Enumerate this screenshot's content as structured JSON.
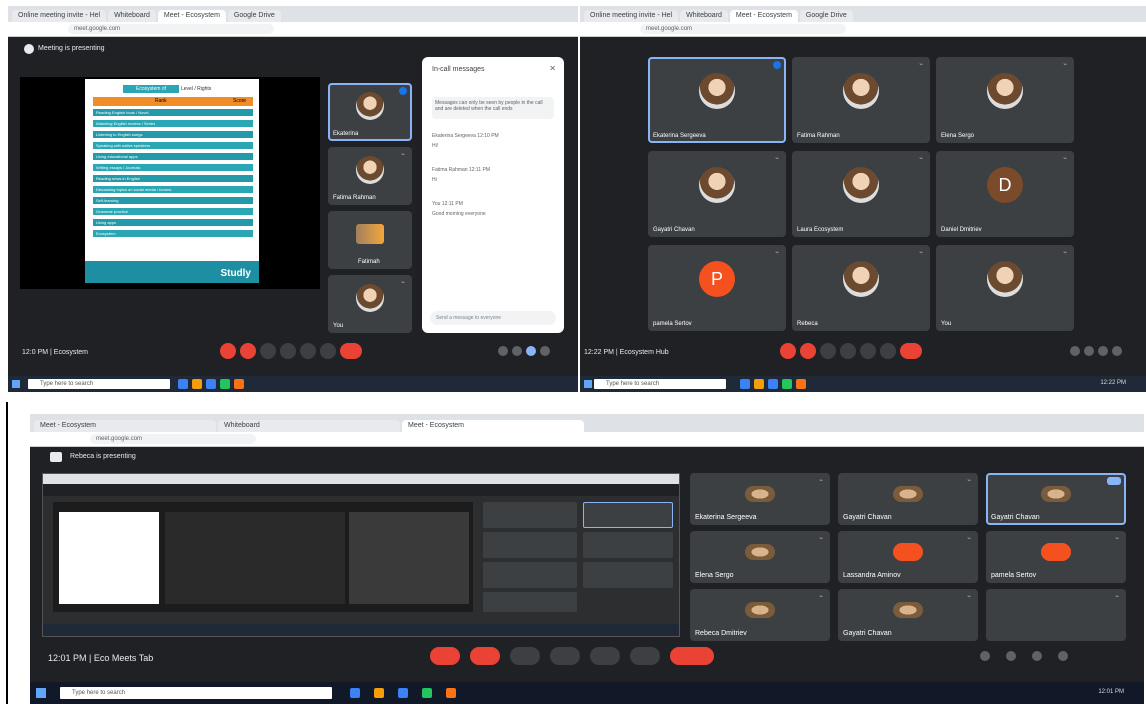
{
  "top_left": {
    "tabs": [
      "Online meeting invite - Hel",
      "Whiteboard",
      "Meet - Ecosystem",
      "Google Drive"
    ],
    "url": "meet.google.com",
    "meeting_title": "Meeting is presenting",
    "time_code": "12:0 PM | Ecosystem",
    "presenter_name": "Ekaterina",
    "presenter_short": "Fatim",
    "slide_header_left": "Ecosystem of",
    "slide_header_right": "Level / Rights",
    "slide_col_a": "Rank",
    "slide_col_b": "Score",
    "slide_rows": [
      "Reading English book / Novel",
      "Watching English movies / Series",
      "Listening to English songs",
      "Speaking with native speakers",
      "Using educational apps",
      "Writing essays / Journals",
      "Reading news in English",
      "Discussing topics on social media / forums",
      "Self-learning",
      "Grammar practice",
      "Using apps",
      "Ecosystem"
    ],
    "slide_brand": "Studly",
    "search_placeholder": "Type here to search",
    "chat": {
      "title": "In-call messages",
      "note": "Messages can only be seen by people in the call and are deleted when the call ends",
      "messages": [
        "Ekaterina Sergeeva 12:10 PM",
        "Hi!",
        "Fatima Rahman 12:11 PM",
        "Hi",
        "You 12:11 PM",
        "Good morning everyone"
      ],
      "input_placeholder": "Send a message to everyone"
    },
    "side_tiles": [
      "Ekaterina",
      "Fatima Rahman",
      "Fatimah",
      "You"
    ]
  },
  "top_right": {
    "time_code": "12:22 PM | Ecosystem Hub",
    "tiles": [
      {
        "name": "Ekaterina Sergeeva",
        "avatar": "photo"
      },
      {
        "name": "Fatima Rahman",
        "avatar": "photo"
      },
      {
        "name": "Elena Sergo",
        "avatar": "photo"
      },
      {
        "name": "Gayatri Chavan",
        "avatar": "photo"
      },
      {
        "name": "Laura Ecosystem",
        "avatar": "photo"
      },
      {
        "name": "Daniel Dmitriev",
        "avatar": "D"
      },
      {
        "name": "pamela Sertov",
        "avatar": "P"
      },
      {
        "name": "Rebeca",
        "avatar": "photo"
      },
      {
        "name": "You",
        "avatar": "photo"
      }
    ],
    "search_placeholder": "Type here to search",
    "clock": "12:22 PM"
  },
  "bottom": {
    "tabs": [
      "Meet - Ecosystem",
      "Whiteboard",
      "Meet - Ecosystem"
    ],
    "meeting_title": "Rebeca is presenting",
    "time_code": "12:01 PM | Eco Meets Tab",
    "tiles": [
      {
        "name": "Ekaterina Sergeeva"
      },
      {
        "name": "Gayatri Chavan"
      },
      {
        "name": "Gayatri Chavan"
      },
      {
        "name": "Elena Sergo"
      },
      {
        "name": "Lassandra Aminov"
      },
      {
        "name": "pamela Sertov"
      },
      {
        "name": "Rebeca Dmitriev"
      },
      {
        "name": "Gayatri Chavan"
      },
      {
        "name": ""
      }
    ],
    "search_placeholder": "Type here to search",
    "clock": "12:01 PM"
  }
}
